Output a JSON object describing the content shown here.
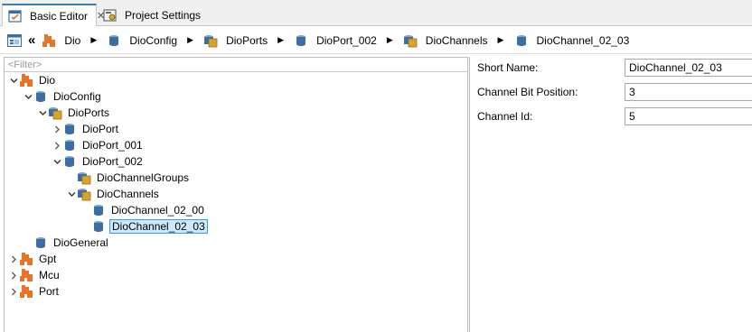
{
  "tabs": [
    {
      "label": "Basic Editor",
      "icon": "basic-editor-icon",
      "close": "✕",
      "active": true
    },
    {
      "label": "Project Settings",
      "icon": "project-settings-icon",
      "active": false
    }
  ],
  "breadcrumb": {
    "items": [
      "Dio",
      "DioConfig",
      "DioPorts",
      "DioPort_002",
      "DioChannels",
      "DioChannel_02_03"
    ]
  },
  "filter": {
    "placeholder": "<Filter>"
  },
  "tree": [
    {
      "label": "Dio",
      "expanded": true
    },
    {
      "label": "DioConfig",
      "expanded": true
    },
    {
      "label": "DioPorts",
      "expanded": true
    },
    {
      "label": "DioPort",
      "expanded": false
    },
    {
      "label": "DioPort_001",
      "expanded": false
    },
    {
      "label": "DioPort_002",
      "expanded": true
    },
    {
      "label": "DioChannelGroups"
    },
    {
      "label": "DioChannels",
      "expanded": true
    },
    {
      "label": "DioChannel_02_00"
    },
    {
      "label": "DioChannel_02_03",
      "selected": true
    },
    {
      "label": "DioGeneral"
    },
    {
      "label": "Gpt",
      "expanded": false
    },
    {
      "label": "Mcu",
      "expanded": false
    },
    {
      "label": "Port",
      "expanded": false
    }
  ],
  "properties": [
    {
      "label": "Short Name:",
      "value": "DioChannel_02_03"
    },
    {
      "label": "Channel Bit Position:",
      "value": "3"
    },
    {
      "label": "Channel Id:",
      "value": "5"
    }
  ],
  "colors": {
    "module_icon": "#e8742a",
    "container_icon": "#3a6ea5",
    "folder_icon": "#d9a42b",
    "selection_bg": "#cde8ff",
    "selection_border": "#3399ff"
  }
}
